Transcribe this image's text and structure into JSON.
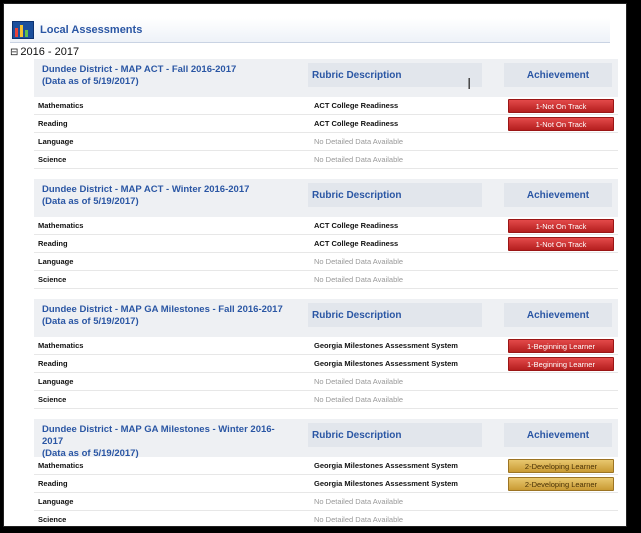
{
  "header": {
    "title": "Local Assessments"
  },
  "year": {
    "toggle": "⊟",
    "label": "2016 - 2017"
  },
  "columns": {
    "rubric": "Rubric Description",
    "achievement": "Achievement"
  },
  "blocks": [
    {
      "title": "Dundee District - MAP ACT - Fall 2016-2017",
      "asof": "(Data as of 5/19/2017)",
      "rows": [
        {
          "subject": "Mathematics",
          "desc": "ACT College Readiness",
          "achievement": "1-Not On Track",
          "level": "red"
        },
        {
          "subject": "Reading",
          "desc": "ACT College Readiness",
          "achievement": "1-Not On Track",
          "level": "red"
        },
        {
          "subject": "Language",
          "desc": "No Detailed Data Available",
          "achievement": "",
          "level": ""
        },
        {
          "subject": "Science",
          "desc": "No Detailed Data Available",
          "achievement": "",
          "level": ""
        }
      ]
    },
    {
      "title": "Dundee District - MAP ACT - Winter 2016-2017",
      "asof": "(Data as of 5/19/2017)",
      "rows": [
        {
          "subject": "Mathematics",
          "desc": "ACT College Readiness",
          "achievement": "1-Not On Track",
          "level": "red"
        },
        {
          "subject": "Reading",
          "desc": "ACT College Readiness",
          "achievement": "1-Not On Track",
          "level": "red"
        },
        {
          "subject": "Language",
          "desc": "No Detailed Data Available",
          "achievement": "",
          "level": ""
        },
        {
          "subject": "Science",
          "desc": "No Detailed Data Available",
          "achievement": "",
          "level": ""
        }
      ]
    },
    {
      "title": "Dundee District - MAP GA Milestones - Fall 2016-2017",
      "asof": "(Data as of 5/19/2017)",
      "rows": [
        {
          "subject": "Mathematics",
          "desc": "Georgia Milestones Assessment System",
          "achievement": "1-Beginning Learner",
          "level": "red"
        },
        {
          "subject": "Reading",
          "desc": "Georgia Milestones Assessment System",
          "achievement": "1-Beginning Learner",
          "level": "red"
        },
        {
          "subject": "Language",
          "desc": "No Detailed Data Available",
          "achievement": "",
          "level": ""
        },
        {
          "subject": "Science",
          "desc": "No Detailed Data Available",
          "achievement": "",
          "level": ""
        }
      ]
    },
    {
      "title": "Dundee District - MAP GA Milestones - Winter 2016-2017",
      "asof": "(Data as of 5/19/2017)",
      "rows": [
        {
          "subject": "Mathematics",
          "desc": "Georgia Milestones Assessment System",
          "achievement": "2-Developing Learner",
          "level": "gold"
        },
        {
          "subject": "Reading",
          "desc": "Georgia Milestones Assessment System",
          "achievement": "2-Developing Learner",
          "level": "gold"
        },
        {
          "subject": "Language",
          "desc": "No Detailed Data Available",
          "achievement": "",
          "level": ""
        },
        {
          "subject": "Science",
          "desc": "No Detailed Data Available",
          "achievement": "",
          "level": ""
        }
      ]
    }
  ],
  "icons": {
    "logo": "bar-chart-logo-icon",
    "cursor": "text-cursor-icon",
    "toggle": "collapse-toggle-icon"
  },
  "colors": {
    "link": "#2a56a4",
    "header_bg": "#eef0f3",
    "red": "#c52a2a",
    "gold": "#d4ac4f"
  }
}
